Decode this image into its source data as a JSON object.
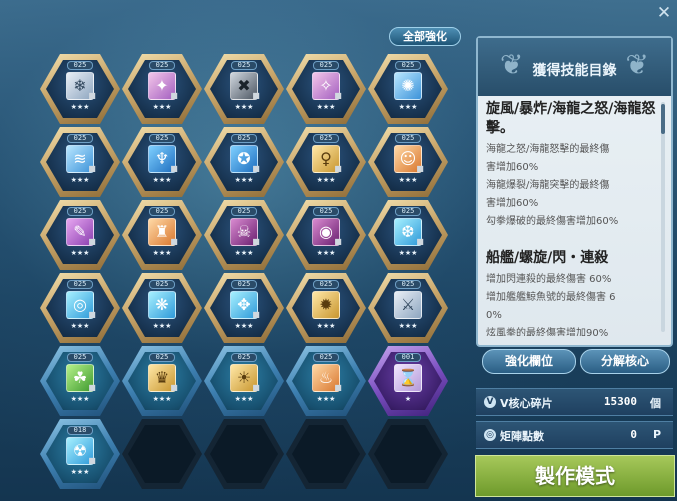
{
  "window": {
    "close_glyph": "✕"
  },
  "toolbar": {
    "all_enhance_label": "全部強化"
  },
  "grid": {
    "slots": [
      {
        "level": "025",
        "stars": "★★★",
        "icon": "❄",
        "color": "ic-silver",
        "frame": "gold",
        "fill": "navy",
        "locked": true
      },
      {
        "level": "025",
        "stars": "★★★",
        "icon": "✦",
        "color": "ic-pink",
        "frame": "gold",
        "fill": "navy",
        "locked": true
      },
      {
        "level": "025",
        "stars": "★★★",
        "icon": "✖",
        "color": "ic-dark",
        "frame": "gold",
        "fill": "navy",
        "locked": true
      },
      {
        "level": "025",
        "stars": "★★★",
        "icon": "✧",
        "color": "ic-pink",
        "frame": "gold",
        "fill": "navy",
        "locked": true
      },
      {
        "level": "025",
        "stars": "★★★",
        "icon": "✺",
        "color": "ic-sky",
        "frame": "gold",
        "fill": "navy",
        "locked": false
      },
      {
        "level": "025",
        "stars": "★★★",
        "icon": "≋",
        "color": "ic-sky",
        "frame": "gold",
        "fill": "navy",
        "locked": true
      },
      {
        "level": "025",
        "stars": "★★★",
        "icon": "♆",
        "color": "ic-blue",
        "frame": "gold",
        "fill": "navy",
        "locked": true
      },
      {
        "level": "025",
        "stars": "★★★",
        "icon": "✪",
        "color": "ic-blue",
        "frame": "gold",
        "fill": "navy",
        "locked": true
      },
      {
        "level": "025",
        "stars": "★★★",
        "icon": "♀",
        "color": "ic-gold",
        "frame": "gold",
        "fill": "navy",
        "locked": true
      },
      {
        "level": "025",
        "stars": "★★★",
        "icon": "☺",
        "color": "ic-orange",
        "frame": "gold",
        "fill": "navy",
        "locked": true
      },
      {
        "level": "025",
        "stars": "★★★",
        "icon": "✎",
        "color": "ic-magenta",
        "frame": "gold",
        "fill": "navy",
        "locked": true
      },
      {
        "level": "025",
        "stars": "★★★",
        "icon": "♜",
        "color": "ic-orange",
        "frame": "gold",
        "fill": "navy",
        "locked": true
      },
      {
        "level": "025",
        "stars": "★★★",
        "icon": "☠",
        "color": "ic-crimson",
        "frame": "gold",
        "fill": "navy",
        "locked": true
      },
      {
        "level": "025",
        "stars": "★★★",
        "icon": "◉",
        "color": "ic-crimson",
        "frame": "gold",
        "fill": "navy",
        "locked": true
      },
      {
        "level": "025",
        "stars": "★★★",
        "icon": "❆",
        "color": "ic-cyan",
        "frame": "gold",
        "fill": "navy",
        "locked": true
      },
      {
        "level": "025",
        "stars": "★★★",
        "icon": "◎",
        "color": "ic-cyan",
        "frame": "gold",
        "fill": "navy",
        "locked": true
      },
      {
        "level": "025",
        "stars": "★★★",
        "icon": "❋",
        "color": "ic-cyan",
        "frame": "gold",
        "fill": "navy",
        "locked": false
      },
      {
        "level": "025",
        "stars": "★★★",
        "icon": "✥",
        "color": "ic-cyan",
        "frame": "gold",
        "fill": "navy",
        "locked": true
      },
      {
        "level": "025",
        "stars": "★★★",
        "icon": "✹",
        "color": "ic-gold",
        "frame": "gold",
        "fill": "navy",
        "locked": false
      },
      {
        "level": "025",
        "stars": "★★★",
        "icon": "⚔",
        "color": "ic-silver",
        "frame": "gold",
        "fill": "navy",
        "locked": false
      },
      {
        "level": "025",
        "stars": "★★★",
        "icon": "☘",
        "color": "ic-green",
        "frame": "blue",
        "fill": "teal",
        "locked": true
      },
      {
        "level": "025",
        "stars": "★★★",
        "icon": "♛",
        "color": "ic-gold",
        "frame": "blue",
        "fill": "teal",
        "locked": true
      },
      {
        "level": "025",
        "stars": "★★★",
        "icon": "☀",
        "color": "ic-gold",
        "frame": "blue",
        "fill": "teal",
        "locked": true
      },
      {
        "level": "025",
        "stars": "★★★",
        "icon": "♨",
        "color": "ic-orange",
        "frame": "blue",
        "fill": "teal",
        "locked": true
      },
      {
        "level": "001",
        "stars": "★",
        "icon": "⌛",
        "color": "ic-purple-item",
        "frame": "purple",
        "fill": "purple",
        "locked": false
      },
      {
        "level": "018",
        "stars": "★★★",
        "icon": "☢",
        "color": "ic-cyan",
        "frame": "blue",
        "fill": "teal",
        "locked": true
      },
      {
        "empty": true
      },
      {
        "empty": true
      },
      {
        "empty": true
      },
      {
        "empty": true
      }
    ]
  },
  "panel": {
    "title": "獲得技能目錄",
    "sections": [
      {
        "title": "旋風/暴炸/海龍之怒/海龍怒擊。",
        "lines": [
          "海龍之怒/海龍怒擊的最終傷",
          "害增加60%",
          "海龍爆裂/海龍突擊的最終傷",
          "害增加60%",
          "勾拳爆破的最終傷害增加60%"
        ]
      },
      {
        "title": "船艦/螺旋/閃・連殺",
        "lines": [
          "增加閃連殺的最終傷害 60%",
          "增加艦艦鯨魚號的最終傷害 6",
          "0%",
          "炫風拳的最終傷害增加90%"
        ]
      }
    ]
  },
  "actions": {
    "enhance_slot_label": "強化欄位",
    "disassemble_core_label": "分解核心"
  },
  "resources": {
    "fragments": {
      "label": "V核心碎片",
      "value": "15300",
      "unit": "個",
      "icon": "V"
    },
    "matrix": {
      "label": "矩陣點數",
      "value": "0",
      "unit": "P",
      "icon": "◎"
    }
  },
  "craft": {
    "label": "製作模式"
  },
  "colors": {
    "accent": "#8fb7cf",
    "craft": "#8ab443"
  }
}
